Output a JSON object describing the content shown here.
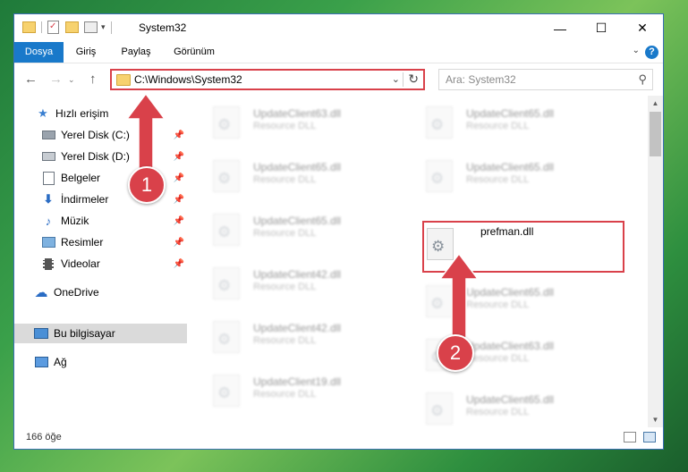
{
  "window": {
    "title": "System32",
    "controls": {
      "minimize": "—",
      "maximize": "☐",
      "close": "✕"
    }
  },
  "ribbon": {
    "tabs": [
      "Dosya",
      "Giriş",
      "Paylaş",
      "Görünüm"
    ],
    "help": "?"
  },
  "nav": {
    "address": "C:\\Windows\\System32",
    "search_placeholder": "Ara: System32"
  },
  "sidebar": {
    "items": [
      {
        "label": "Hızlı erişim",
        "icon": "star-icon"
      },
      {
        "label": "Yerel Disk (C:)",
        "icon": "drive-icon"
      },
      {
        "label": "Yerel Disk (D:)",
        "icon": "drive-icon"
      },
      {
        "label": "Belgeler",
        "icon": "documents-icon"
      },
      {
        "label": "İndirmeler",
        "icon": "download-icon"
      },
      {
        "label": "Müzik",
        "icon": "music-icon"
      },
      {
        "label": "Resimler",
        "icon": "pictures-icon"
      },
      {
        "label": "Videolar",
        "icon": "video-icon"
      },
      {
        "label": "OneDrive",
        "icon": "cloud-icon"
      },
      {
        "label": "Bu bilgisayar",
        "icon": "computer-icon"
      },
      {
        "label": "Ağ",
        "icon": "network-icon"
      }
    ]
  },
  "files": {
    "left": [
      {
        "name": "UpdateClient63.dll",
        "desc": "Resource DLL"
      },
      {
        "name": "UpdateClient65.dll",
        "desc": "Resource DLL"
      },
      {
        "name": "UpdateClient65.dll",
        "desc": "Resource DLL"
      },
      {
        "name": "UpdateClient42.dll",
        "desc": "Resource DLL"
      },
      {
        "name": "UpdateClient42.dll",
        "desc": "Resource DLL"
      },
      {
        "name": "UpdateClient19.dll",
        "desc": "Resource DLL"
      }
    ],
    "right": [
      {
        "name": "UpdateClient65.dll",
        "desc": "Resource DLL"
      },
      {
        "name": "UpdateClient65.dll",
        "desc": "Resource DLL"
      },
      {
        "name": "prefman.dll",
        "desc": ""
      },
      {
        "name": "UpdateClient65.dll",
        "desc": "Resource DLL"
      },
      {
        "name": "UpdateClient63.dll",
        "desc": "Resource DLL"
      },
      {
        "name": "UpdateClient65.dll",
        "desc": "Resource DLL"
      }
    ]
  },
  "status": {
    "count": "166 öğe"
  },
  "annotations": {
    "step1": "1",
    "step2": "2",
    "color": "#d9414a"
  }
}
